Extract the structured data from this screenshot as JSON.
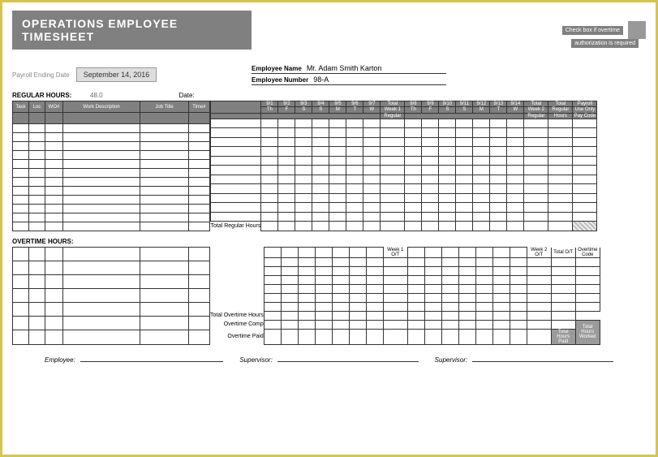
{
  "title": "OPERATIONS EMPLOYEE TIMESHEET",
  "checkbox_text": "Check box if overtime",
  "auth_text": "authorization is required",
  "payroll_label": "Payroll Ending Date",
  "payroll_date": "September 14, 2016",
  "emp_name_label": "Employee Name",
  "emp_name": "Mr. Adam Smith Karton",
  "emp_num_label": "Employee Number",
  "emp_num": "98-A",
  "regular_label": "REGULAR HOURS:",
  "regular_val": "48.0",
  "date_label": "Date:",
  "cols_left": {
    "task": "Task",
    "loc": "Loc",
    "wo": "WO#",
    "desc": "Work Description",
    "job": "Job Title",
    "time": "Time#"
  },
  "days1_top": [
    "9/1",
    "9/2",
    "9/3",
    "9/4",
    "9/5",
    "9/6",
    "9/7"
  ],
  "days1_bot": [
    "Th",
    "F",
    "S",
    "S",
    "M",
    "T",
    "W"
  ],
  "days2_top": [
    "9/8",
    "9/9",
    "9/10",
    "9/11",
    "9/12",
    "9/13",
    "9/14"
  ],
  "days2_bot": [
    "Th",
    "F",
    "S",
    "S",
    "M",
    "T",
    "W"
  ],
  "total_w1_top": "Total",
  "total_w1_mid": "Week 1",
  "total_w1_bot": "Regular",
  "total_w2_top": "Total",
  "total_w2_mid": "Week 2",
  "total_w2_bot": "Regular",
  "total_reg_top": "Total",
  "total_reg_mid": "Regular",
  "total_reg_bot": "Hours",
  "pay_top": "Payroll",
  "pay_mid": "Use Only",
  "pay_bot": "Pay Code",
  "total_regular_hours": "Total Regular Hours",
  "overtime_label": "OVERTIME HOURS:",
  "w1ot": "Week 1 O/T",
  "w2ot": "Week 2 O/T",
  "totot": "Total O/T",
  "otcode": "Overtime Code",
  "tot_ot_hours": "Total Overtime Hours",
  "ot_comp": "Overtime Comp",
  "ot_paid": "Overtime Paid",
  "tot_hrs_worked": "Total Hours Worked",
  "tot_hrs_paid": "Total Hours Paid",
  "sig_emp": "Employee:",
  "sig_sup": "Supervisor:",
  "sig_sup2": "Supervisor:"
}
